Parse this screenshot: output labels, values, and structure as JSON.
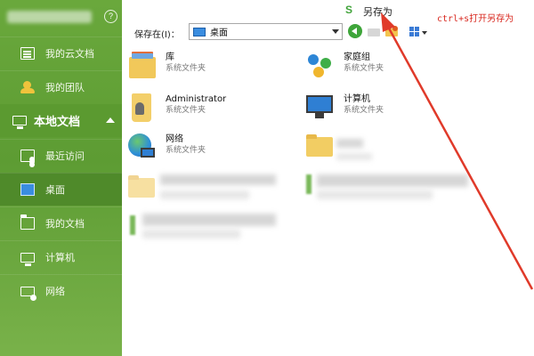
{
  "sidebar": {
    "help_glyph": "?",
    "items": [
      {
        "label": "我的云文档",
        "icon": "cloud-doc-icon"
      },
      {
        "label": "我的团队",
        "icon": "team-icon"
      }
    ],
    "section": {
      "label": "本地文档",
      "icon": "monitor-icon"
    },
    "local_items": [
      {
        "label": "最近访问",
        "icon": "recent-icon"
      },
      {
        "label": "桌面",
        "icon": "desktop-icon"
      },
      {
        "label": "我的文档",
        "icon": "folder-icon"
      },
      {
        "label": "计算机",
        "icon": "computer-icon"
      },
      {
        "label": "网络",
        "icon": "network-icon"
      }
    ]
  },
  "dialog": {
    "logo_glyph": "S",
    "title": "另存为",
    "annotation": "ctrl+s打开另存为",
    "annotation_color": "#d8281f"
  },
  "toolbar": {
    "save_in_label": "保存在(I)：",
    "location_value": "桌面"
  },
  "files": [
    {
      "name": "库",
      "type": "系统文件夹",
      "icon": "library-icon"
    },
    {
      "name": "家庭组",
      "type": "系统文件夹",
      "icon": "homegroup-icon"
    },
    {
      "name": "Administrator",
      "type": "系统文件夹",
      "icon": "user-folder-icon"
    },
    {
      "name": "计算机",
      "type": "系统文件夹",
      "icon": "computer-icon"
    },
    {
      "name": "网络",
      "type": "系统文件夹",
      "icon": "network-icon"
    }
  ],
  "colors": {
    "sidebar_green": "#5d9c33",
    "active_item": "#4f8a2a",
    "accent_green": "#41a33a"
  }
}
